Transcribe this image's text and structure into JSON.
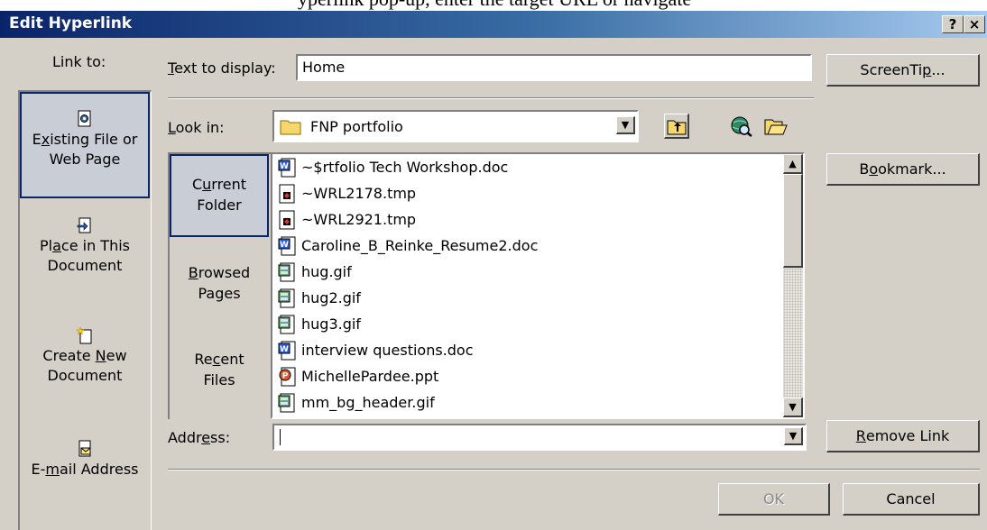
{
  "caption_fragment": "yperlink pop-up, enter the target URL or navigate",
  "window": {
    "title": "Edit Hyperlink",
    "help_btn": "?",
    "close_btn": "×"
  },
  "link_to": {
    "header": "Link to:",
    "items": [
      {
        "line1": "Existing File or",
        "line2": "Web Page",
        "icon": "existing-file-icon",
        "selected": true
      },
      {
        "line1": "Place in This",
        "line2": "Document",
        "icon": "place-in-document-icon",
        "selected": false
      },
      {
        "line1": "Create New",
        "line2": "Document",
        "icon": "new-document-icon",
        "selected": false
      },
      {
        "line1": "E-mail Address",
        "line2": "",
        "icon": "email-icon",
        "selected": false
      }
    ]
  },
  "text_to_display": {
    "label": "Text to display:",
    "value": "Home"
  },
  "screentip_button": "ScreenTip...",
  "look_in": {
    "label": "Look in:",
    "value": "FNP portfolio"
  },
  "toolbar_icons": [
    "up-one-folder-icon",
    "browse-web-icon",
    "browse-file-icon"
  ],
  "nav": [
    {
      "line1": "Current",
      "line2": "Folder",
      "selected": true
    },
    {
      "line1": "Browsed",
      "line2": "Pages",
      "selected": false
    },
    {
      "line1": "Recent",
      "line2": "Files",
      "selected": false
    }
  ],
  "files": [
    {
      "name": "~$rtfolio Tech Workshop.doc",
      "icon": "word-doc-icon"
    },
    {
      "name": "~WRL2178.tmp",
      "icon": "tmp-file-icon"
    },
    {
      "name": "~WRL2921.tmp",
      "icon": "tmp-file-icon"
    },
    {
      "name": "Caroline_B_Reinke_Resume2.doc",
      "icon": "word-doc-icon"
    },
    {
      "name": "hug.gif",
      "icon": "gif-file-icon"
    },
    {
      "name": "hug2.gif",
      "icon": "gif-file-icon"
    },
    {
      "name": "hug3.gif",
      "icon": "gif-file-icon"
    },
    {
      "name": "interview questions.doc",
      "icon": "word-doc-icon"
    },
    {
      "name": "MichellePardee.ppt",
      "icon": "ppt-file-icon"
    },
    {
      "name": "mm_bg_header.gif",
      "icon": "gif-file-icon"
    }
  ],
  "bookmark_button": "Bookmark...",
  "address": {
    "label": "Address:",
    "value": ""
  },
  "remove_link_button": "Remove Link",
  "ok_button": "OK",
  "cancel_button": "Cancel",
  "colors": {
    "title_start": "#0a246a",
    "title_end": "#a6caf0",
    "face": "#d4d0c8"
  }
}
